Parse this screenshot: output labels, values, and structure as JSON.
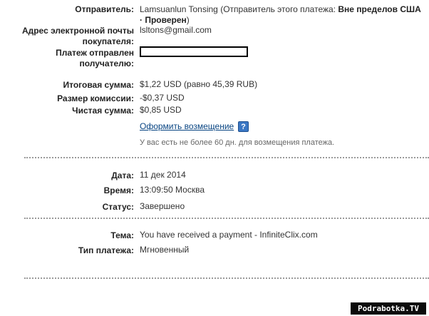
{
  "details": {
    "sender_label": "Отправитель:",
    "sender_name": "Lamsuanlun Tonsing",
    "sender_note_open": " (Отправитель этого платежа: ",
    "sender_status": "Вне пределов США · Проверен",
    "sender_note_close": ")",
    "buyer_email_label": "Адрес электронной почты покупателя:",
    "buyer_email": "lsltons@gmail.com",
    "recipient_label": "Платеж отправлен получателю:"
  },
  "amounts": {
    "total_label": "Итоговая сумма:",
    "total_value": "$1,22 USD (равно 45,39 RUB)",
    "fee_label": "Размер комиссии:",
    "fee_value": "-$0,37 USD",
    "net_label": "Чистая сумма:",
    "net_value": "$0,85 USD",
    "refund_link": "Оформить возмещение",
    "help_icon": "?",
    "refund_note": "У вас есть не более 60 дн. для возмещения платежа."
  },
  "status_block": {
    "date_label": "Дата:",
    "date_value": "11 дек 2014",
    "time_label": "Время:",
    "time_value": "13:09:50 Москва",
    "status_label": "Статус:",
    "status_value": "Завершено"
  },
  "subject_block": {
    "subject_label": "Тема:",
    "subject_value": "You have received a payment - InfiniteClix.com",
    "type_label": "Тип платежа:",
    "type_value": "Мгновенный"
  },
  "watermark": {
    "text": "Podrabotka.TV"
  }
}
